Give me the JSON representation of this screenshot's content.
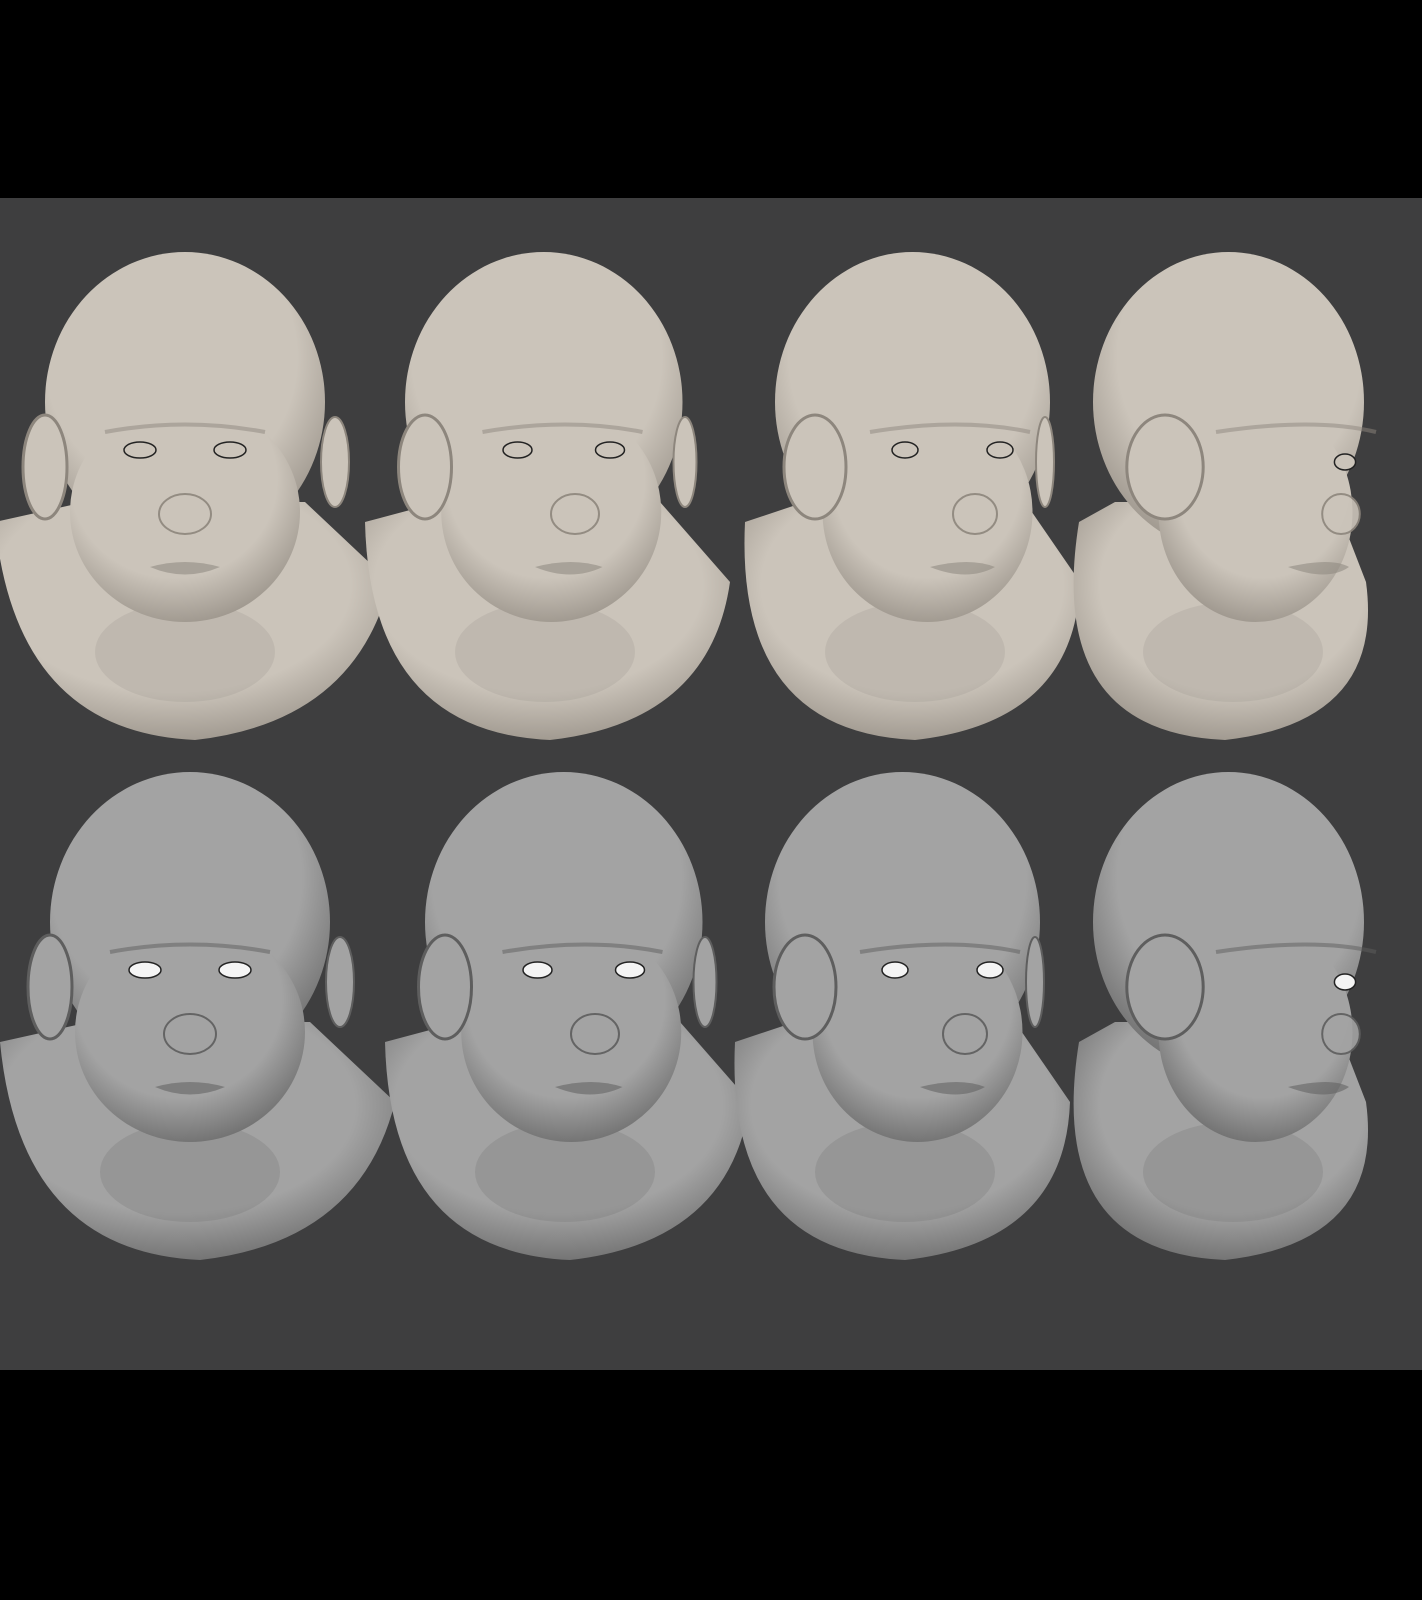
{
  "colors": {
    "background": "#000000",
    "panel": "#3e3e3f",
    "textured_skin": "#cbc4ba",
    "textured_shadow": "#8d867d",
    "clay": "#a3a3a3",
    "clay_shadow": "#5e5e5e",
    "eye_white": "#f4f4f4"
  },
  "rows": [
    {
      "material": "textured",
      "views": [
        "front",
        "three-quarter-left",
        "three-quarter",
        "profile"
      ]
    },
    {
      "material": "clay",
      "views": [
        "front",
        "three-quarter-left",
        "three-quarter",
        "profile"
      ]
    }
  ]
}
